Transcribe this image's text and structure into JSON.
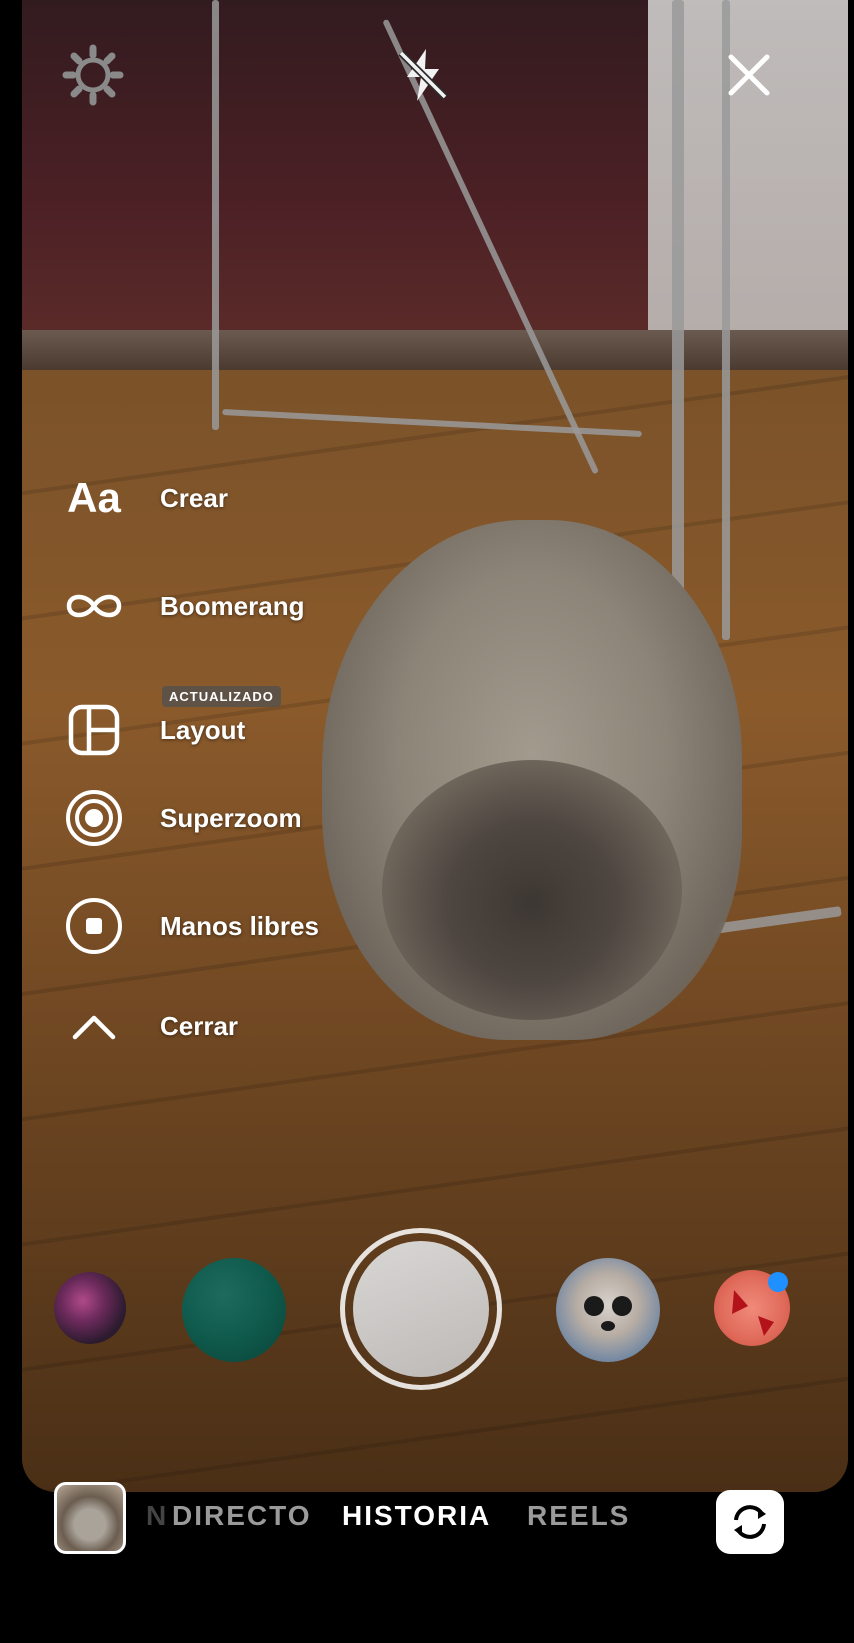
{
  "top_bar": {
    "settings_icon": "gear-icon",
    "flash_icon": "flash-off-icon",
    "close_icon": "close-icon"
  },
  "side_menu": {
    "items": [
      {
        "icon": "text-aa-icon",
        "icon_text": "Aa",
        "label": "Crear"
      },
      {
        "icon": "infinity-icon",
        "label": "Boomerang"
      },
      {
        "icon": "layout-grid-icon",
        "label": "Layout",
        "badge": "ACTUALIZADO"
      },
      {
        "icon": "superzoom-icon",
        "label": "Superzoom"
      },
      {
        "icon": "hands-free-icon",
        "label": "Manos libres"
      },
      {
        "icon": "chevron-up-icon",
        "label": "Cerrar"
      }
    ]
  },
  "effects": {
    "items": [
      "pink-swirl-effect",
      "green-texture-effect",
      "chihuahua-face-effect",
      "butterfly-effect"
    ],
    "new_indicator_color": "#1e90ff"
  },
  "bottom_bar": {
    "modes": {
      "partial": "N",
      "live": "DIRECTO",
      "story": "HISTORIA",
      "reels": "REELS"
    },
    "active_mode": "HISTORIA",
    "flip_icon": "flip-camera-icon"
  }
}
